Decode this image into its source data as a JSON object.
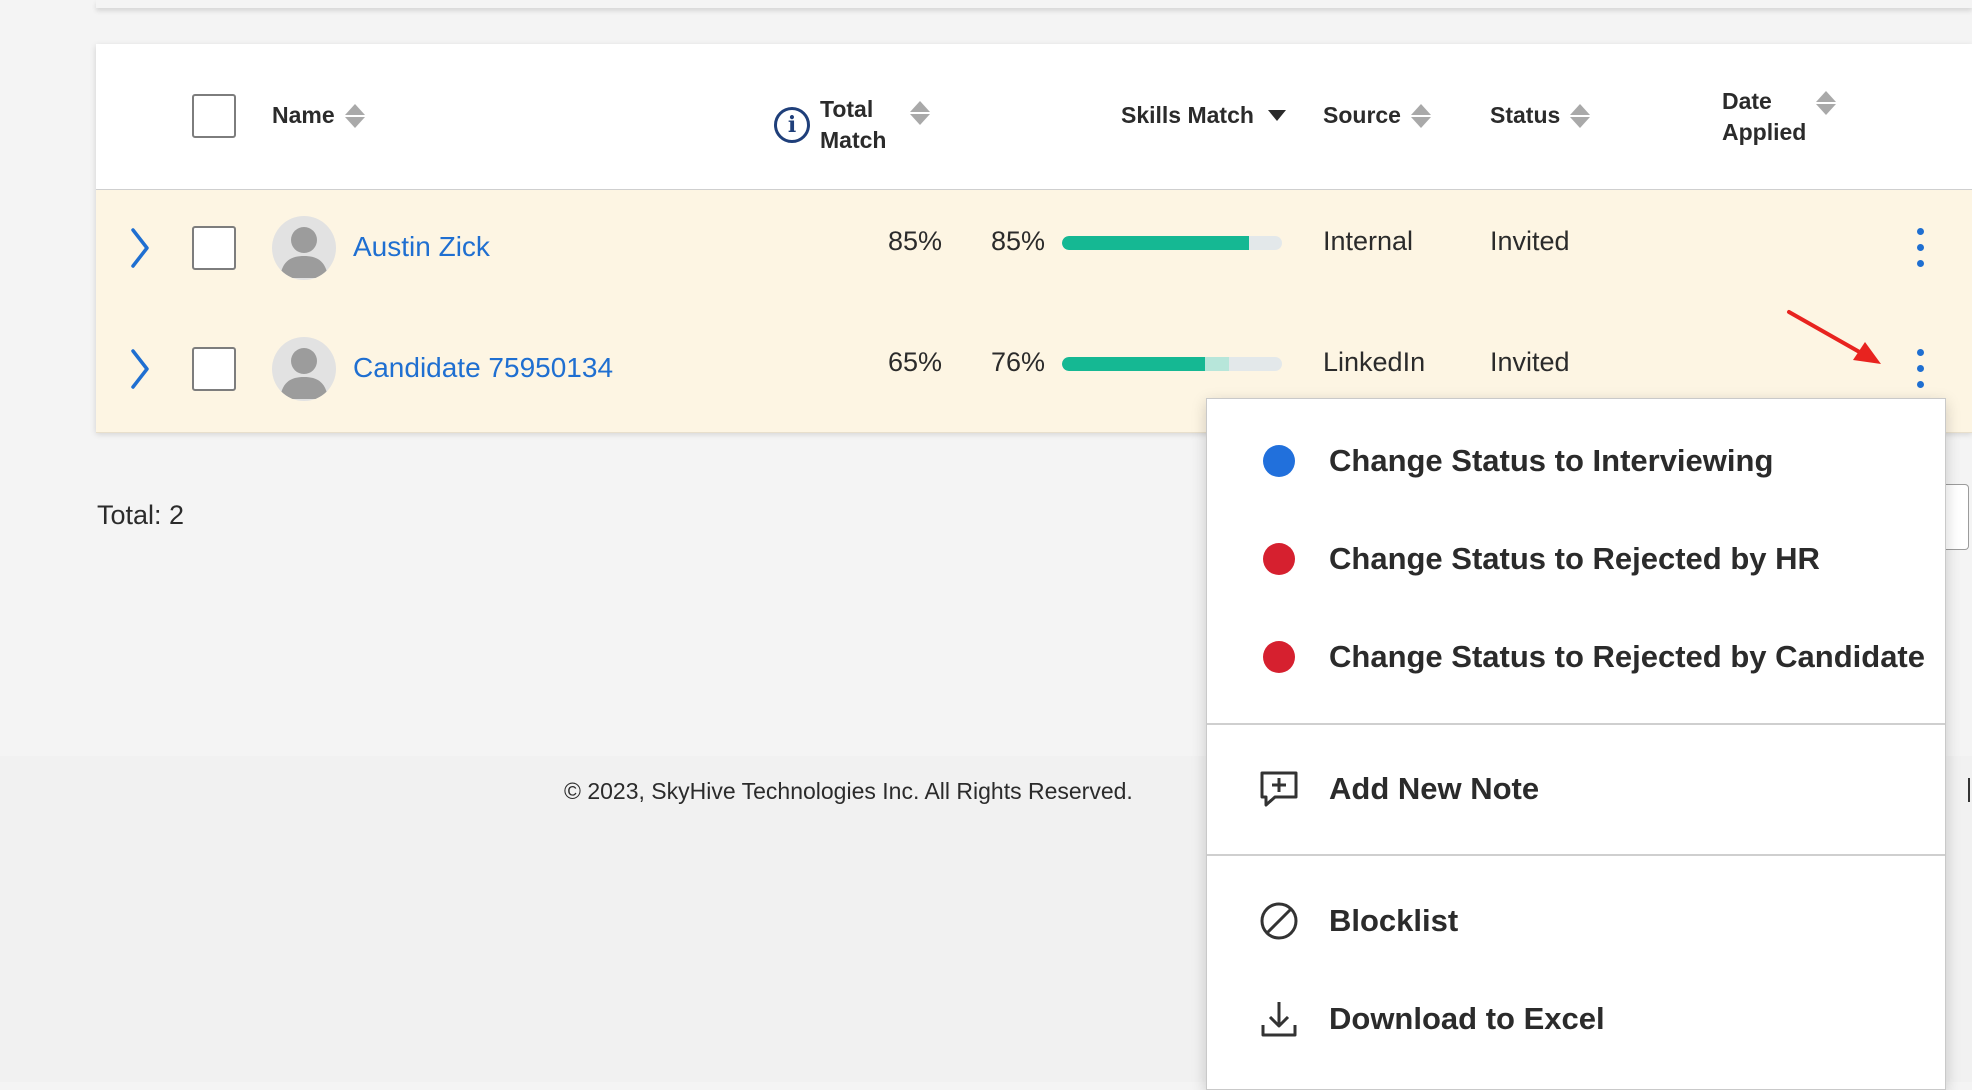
{
  "table": {
    "headers": {
      "name": "Name",
      "total_match_line1": "Total",
      "total_match_line2": "Match",
      "skills_match": "Skills Match",
      "source": "Source",
      "status": "Status",
      "date_applied_line1": "Date",
      "date_applied_line2": "Applied"
    },
    "rows": [
      {
        "name": "Austin Zick",
        "total_match": "85%",
        "skills_match": "85%",
        "skills_match_fraction": 0.85,
        "source": "Internal",
        "status": "Invited"
      },
      {
        "name": "Candidate 75950134",
        "total_match": "65%",
        "skills_match": "76%",
        "skills_match_fraction": 0.65,
        "skills_match_secondary_fraction": 0.76,
        "source": "LinkedIn",
        "status": "Invited"
      }
    ]
  },
  "total_label": "Total: 2",
  "footer": {
    "copyright": "© 2023, SkyHive Technologies Inc. All Rights Reserved."
  },
  "context_menu": {
    "items": [
      {
        "label": "Change Status to Interviewing",
        "dot_color": "#2170dc"
      },
      {
        "label": "Change Status to Rejected by HR",
        "dot_color": "#d6202f"
      },
      {
        "label": "Change Status to Rejected by Candidate",
        "dot_color": "#d6202f"
      },
      {
        "label": "Add New Note",
        "icon": "note-add-icon"
      },
      {
        "label": "Blocklist",
        "icon": "block-icon"
      },
      {
        "label": "Download to Excel",
        "icon": "download-icon"
      }
    ]
  },
  "colors": {
    "accent": "#1f6fd1",
    "row_highlight": "#fdf5e3",
    "bar": "#15b893",
    "annotation_arrow": "#e8231f"
  }
}
